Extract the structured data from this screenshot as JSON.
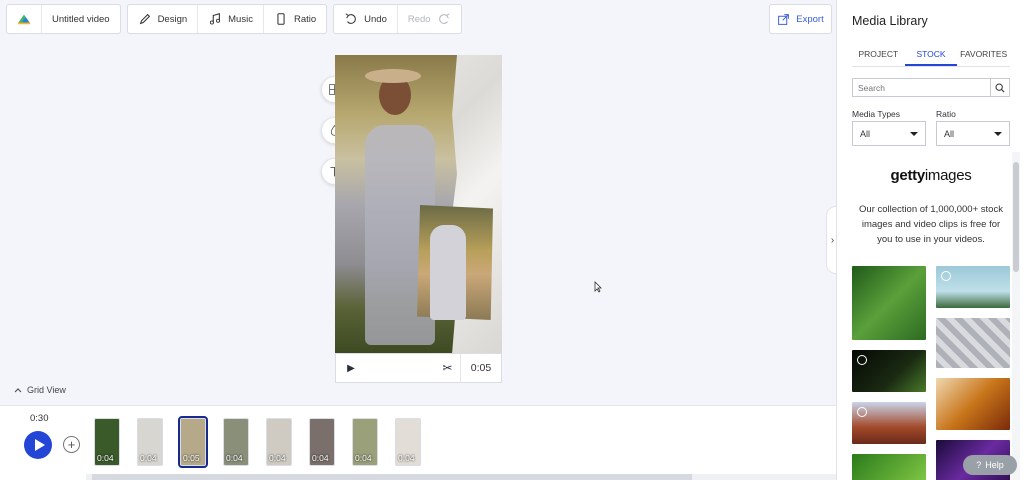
{
  "toolbar": {
    "project_title": "Untitled video",
    "design_label": "Design",
    "music_label": "Music",
    "ratio_label": "Ratio",
    "undo_label": "Undo",
    "redo_label": "Redo",
    "export_label": "Export"
  },
  "playbar": {
    "time": "0:05"
  },
  "grid_view_label": "Grid View",
  "timeline": {
    "total_time": "0:30",
    "clips": [
      {
        "duration": "0:04",
        "color": "#3a5a2a"
      },
      {
        "duration": "0:04",
        "color": "#d8d6d0"
      },
      {
        "duration": "0:05",
        "color": "#b5a98a"
      },
      {
        "duration": "0:04",
        "color": "#8a8f7a"
      },
      {
        "duration": "0:04",
        "color": "#cfcbc2"
      },
      {
        "duration": "0:04",
        "color": "#7a6f6a"
      },
      {
        "duration": "0:04",
        "color": "#9aa07a"
      },
      {
        "duration": "0:04",
        "color": "#e2ddd6"
      }
    ]
  },
  "panel": {
    "title": "Media Library",
    "tabs": [
      "PROJECT",
      "STOCK",
      "FAVORITES"
    ],
    "active_tab": "STOCK",
    "search_placeholder": "Search",
    "media_types_label": "Media Types",
    "media_types_value": "All",
    "ratio_label": "Ratio",
    "ratio_value": "All",
    "brand_bold": "getty",
    "brand_light": "images",
    "description": "Our collection of 1,000,000+ stock images and video clips is free for you to use in your videos.",
    "help_label": "Help"
  },
  "colors": {
    "accent": "#2446d6",
    "selected_clip_outline": "#1a2a8a"
  }
}
